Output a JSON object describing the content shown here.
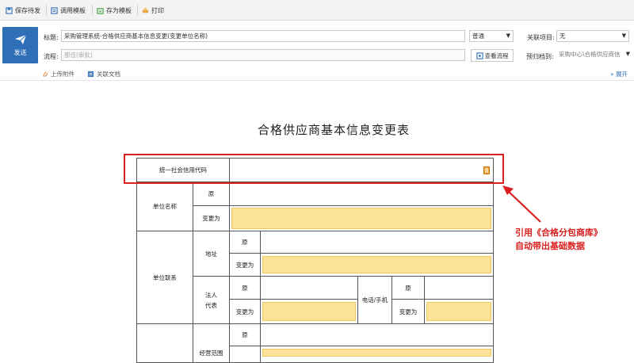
{
  "toolbar": {
    "save_send": "保存待发",
    "use_template": "调用模板",
    "save_template": "存为模板",
    "print": "打印"
  },
  "header": {
    "send_label": "发送",
    "title_label": "标题:",
    "title_value": "采购管理系统-合格供应商基本信息变更(变更单位名称)",
    "flow_label": "流程:",
    "flow_placeholder": "那佳(审批)",
    "priority_value": "普通",
    "related_label": "关联项目:",
    "related_value": "无",
    "view_flow": "查看流程",
    "archive_label": "预归档到:",
    "archive_value": "采购中心\\合格供应商信"
  },
  "attach": {
    "upload": "上传附件",
    "related_doc": "关联文档",
    "expand": "展开"
  },
  "form": {
    "title": "合格供应商基本信息变更表",
    "credit_code": "统一社会信用代码",
    "unit_name": "单位名称",
    "original": "原",
    "change_to": "变更为",
    "unit_contact": "单位联系",
    "address": "地址",
    "legal_rep": "法人\n代表",
    "phone": "电话/手机",
    "business_scope": "经营范围"
  },
  "annotation": {
    "line1": "引用《合格分包商库》",
    "line2": "自动带出基础数据"
  },
  "colors": {
    "accent": "#2f6fb8",
    "highlight": "#fde39a",
    "annotation": "#d9201f"
  }
}
